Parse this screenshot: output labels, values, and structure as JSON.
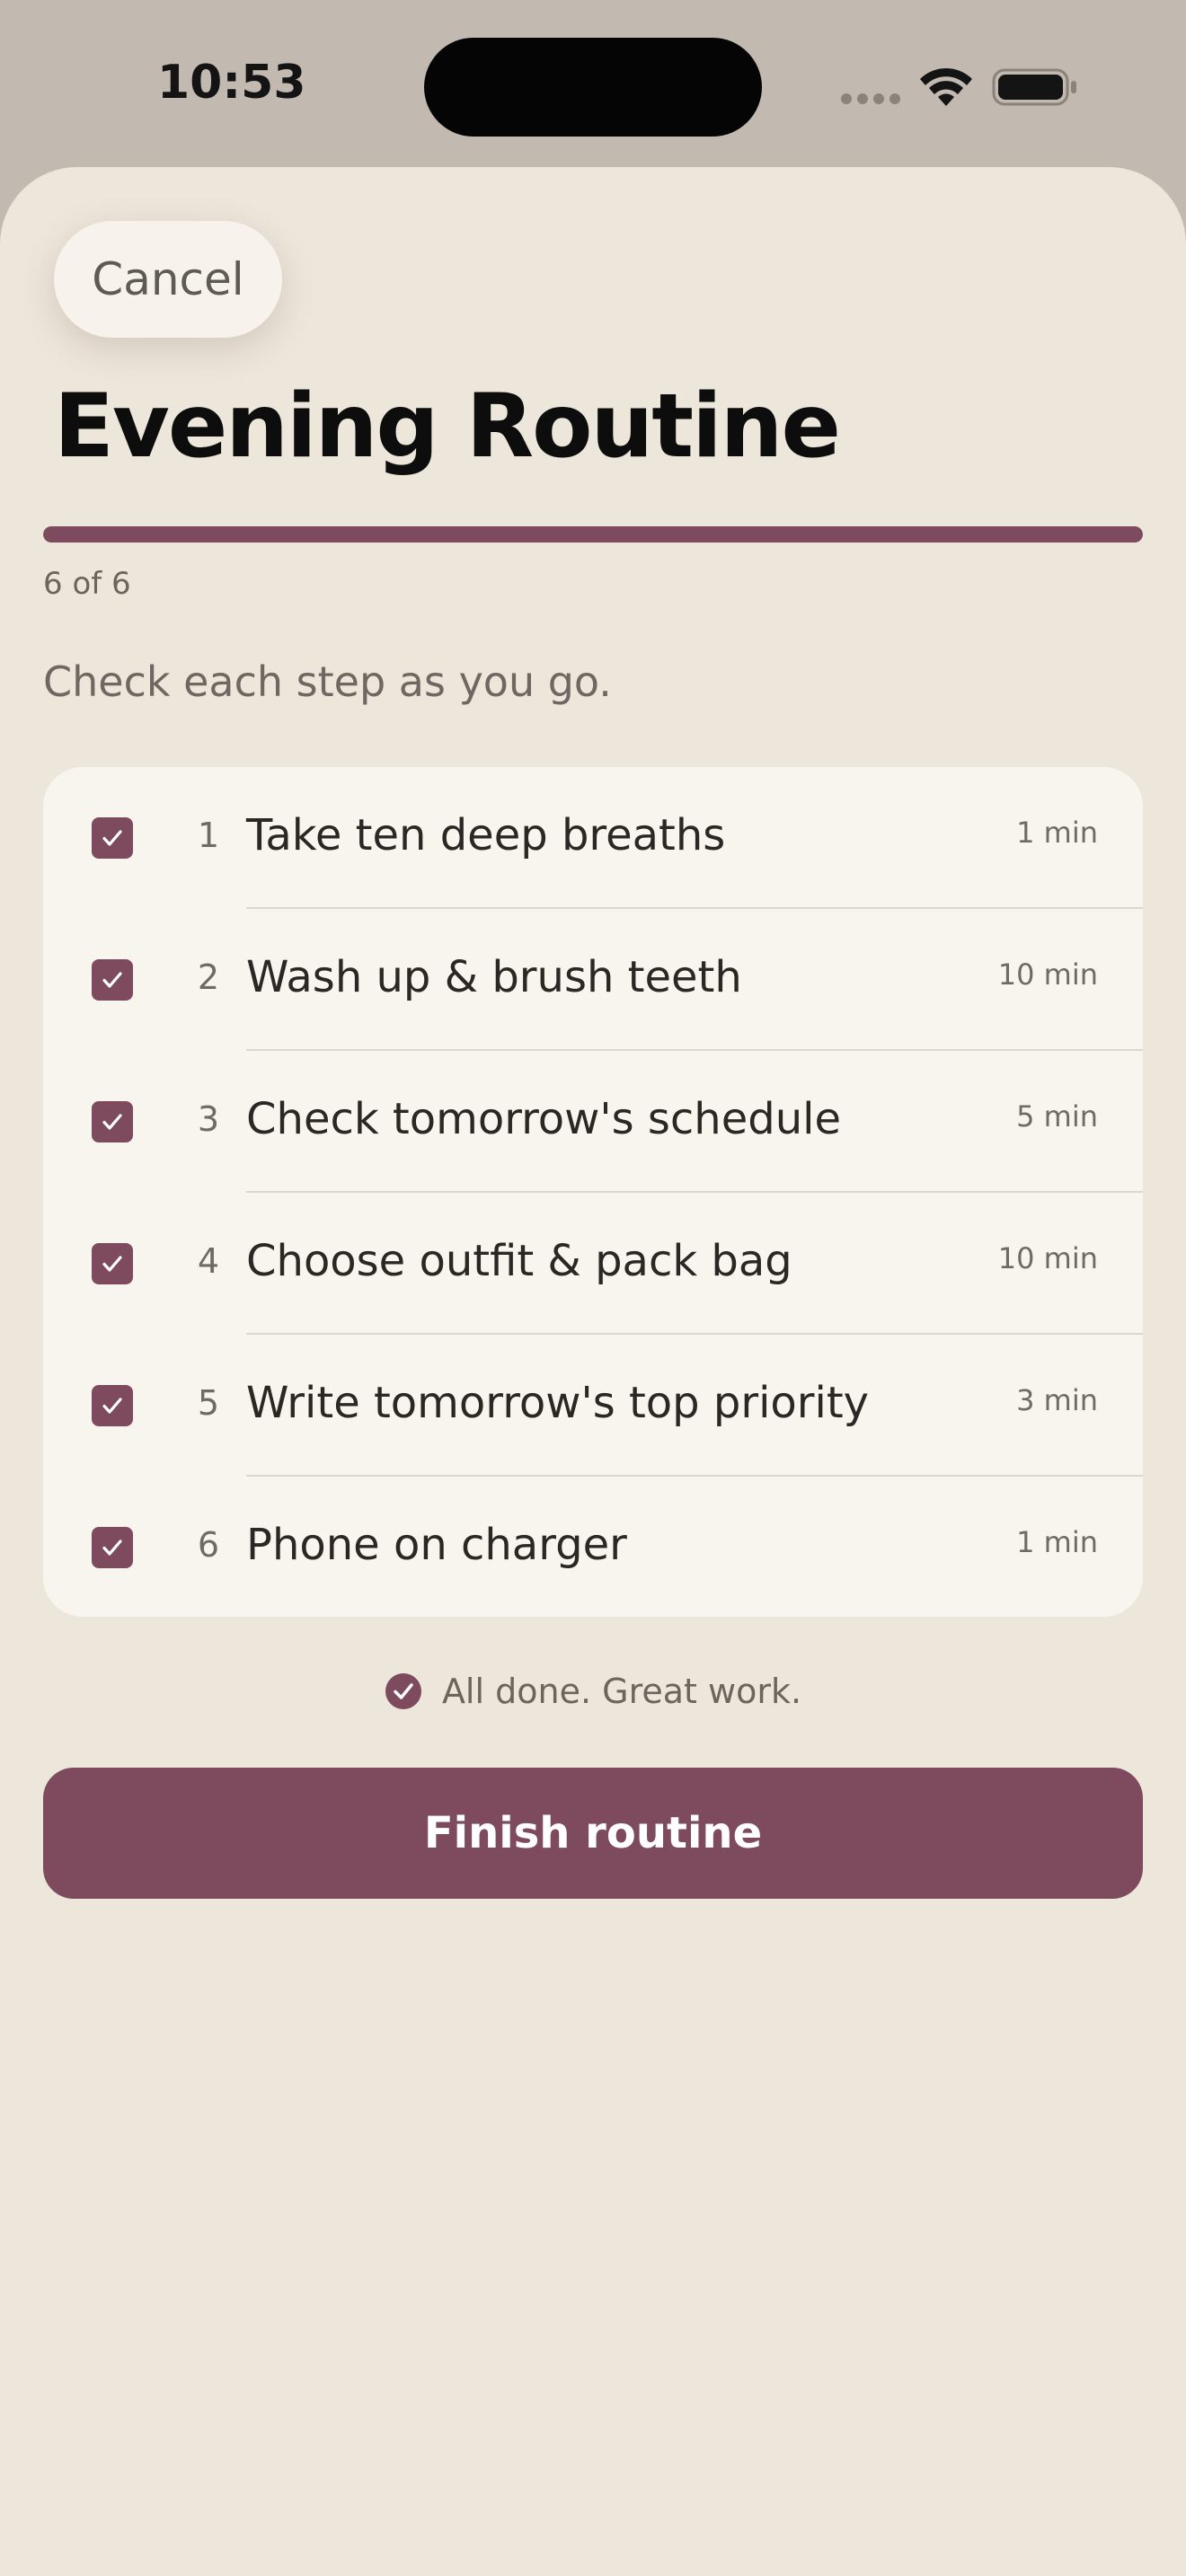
{
  "status_bar": {
    "time": "10:53"
  },
  "header": {
    "cancel_label": "Cancel",
    "title": "Evening Routine"
  },
  "progress": {
    "label": "6 of 6",
    "completed": 6,
    "total": 6,
    "fraction": 1.0
  },
  "instruction": "Check each step as you go.",
  "steps": [
    {
      "number": "1",
      "label": "Take ten deep breaths",
      "duration": "1 min",
      "checked": true
    },
    {
      "number": "2",
      "label": "Wash up & brush teeth",
      "duration": "10 min",
      "checked": true
    },
    {
      "number": "3",
      "label": "Check tomorrow's schedule",
      "duration": "5 min",
      "checked": true
    },
    {
      "number": "4",
      "label": "Choose outfit & pack bag",
      "duration": "10 min",
      "checked": true
    },
    {
      "number": "5",
      "label": "Write tomorrow's top priority",
      "duration": "3 min",
      "checked": true
    },
    {
      "number": "6",
      "label": "Phone on charger",
      "duration": "1 min",
      "checked": true
    }
  ],
  "completion_message": "All done. Great work.",
  "finish_label": "Finish routine",
  "colors": {
    "accent": "#7d4a5e",
    "background": "#ede6db",
    "card": "#f8f5ef"
  },
  "icons": {
    "checkbox": "checkmark-icon",
    "done": "check-circle-icon",
    "wifi": "wifi-icon",
    "battery": "battery-icon"
  }
}
